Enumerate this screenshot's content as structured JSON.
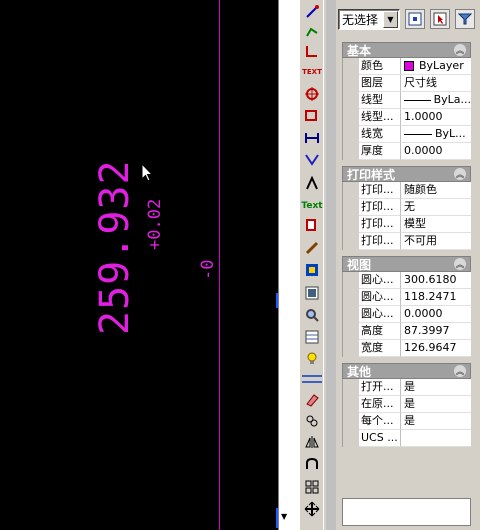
{
  "canvas": {
    "dimension_value": "259.932",
    "tol_upper": "+0.02",
    "tol_lower": "-0"
  },
  "toolbar": {
    "items": [
      {
        "icon": "line-icon"
      },
      {
        "icon": "polyline-icon"
      },
      {
        "icon": "arc-dim-icon"
      },
      {
        "icon": "text-style-icon",
        "label": "TEXT"
      },
      {
        "icon": "center-mark-icon"
      },
      {
        "icon": "rectangle-icon"
      },
      {
        "icon": "dim-linear-icon"
      },
      {
        "icon": "dim-aligned-icon"
      },
      {
        "icon": "move-point-icon"
      },
      {
        "icon": "text-icon",
        "label": "Text"
      },
      {
        "icon": "copy-icon"
      },
      {
        "icon": "edit-icon"
      },
      {
        "icon": "block-icon"
      },
      {
        "icon": "image-icon"
      },
      {
        "icon": "search-icon"
      },
      {
        "icon": "table-icon"
      },
      {
        "icon": "lightbulb-icon"
      },
      {
        "icon": "eraser-icon"
      },
      {
        "icon": "copy-object-icon"
      },
      {
        "icon": "mirror-icon"
      },
      {
        "icon": "offset-icon"
      },
      {
        "icon": "array-icon"
      },
      {
        "icon": "move-icon"
      }
    ]
  },
  "properties": {
    "selection": "无选择",
    "sections": [
      {
        "title": "基本",
        "rows": [
          {
            "key": "颜色",
            "value": "ByLayer",
            "type": "color"
          },
          {
            "key": "图层",
            "value": "尺寸线"
          },
          {
            "key": "线型",
            "value": "ByLa...",
            "type": "line"
          },
          {
            "key": "线型...",
            "value": "1.0000"
          },
          {
            "key": "线宽",
            "value": "ByL...",
            "type": "line"
          },
          {
            "key": "厚度",
            "value": "0.0000"
          }
        ]
      },
      {
        "title": "打印样式",
        "rows": [
          {
            "key": "打印...",
            "value": "随颜色"
          },
          {
            "key": "打印...",
            "value": "无"
          },
          {
            "key": "打印...",
            "value": "模型"
          },
          {
            "key": "打印...",
            "value": "不可用"
          }
        ]
      },
      {
        "title": "视图",
        "rows": [
          {
            "key": "圆心...",
            "value": "300.6180"
          },
          {
            "key": "圆心...",
            "value": "118.2471"
          },
          {
            "key": "圆心...",
            "value": "0.0000"
          },
          {
            "key": "高度",
            "value": "87.3997"
          },
          {
            "key": "宽度",
            "value": "126.9647"
          }
        ]
      },
      {
        "title": "其他",
        "rows": [
          {
            "key": "打开...",
            "value": "是"
          },
          {
            "key": "在原...",
            "value": "是"
          },
          {
            "key": "每个...",
            "value": "是"
          },
          {
            "key": "UCS ...",
            "value": ""
          }
        ]
      }
    ]
  },
  "colors": {
    "dimension": "#e020e0",
    "canvas_bg": "#000000",
    "accent_blue": "#2060ff"
  }
}
